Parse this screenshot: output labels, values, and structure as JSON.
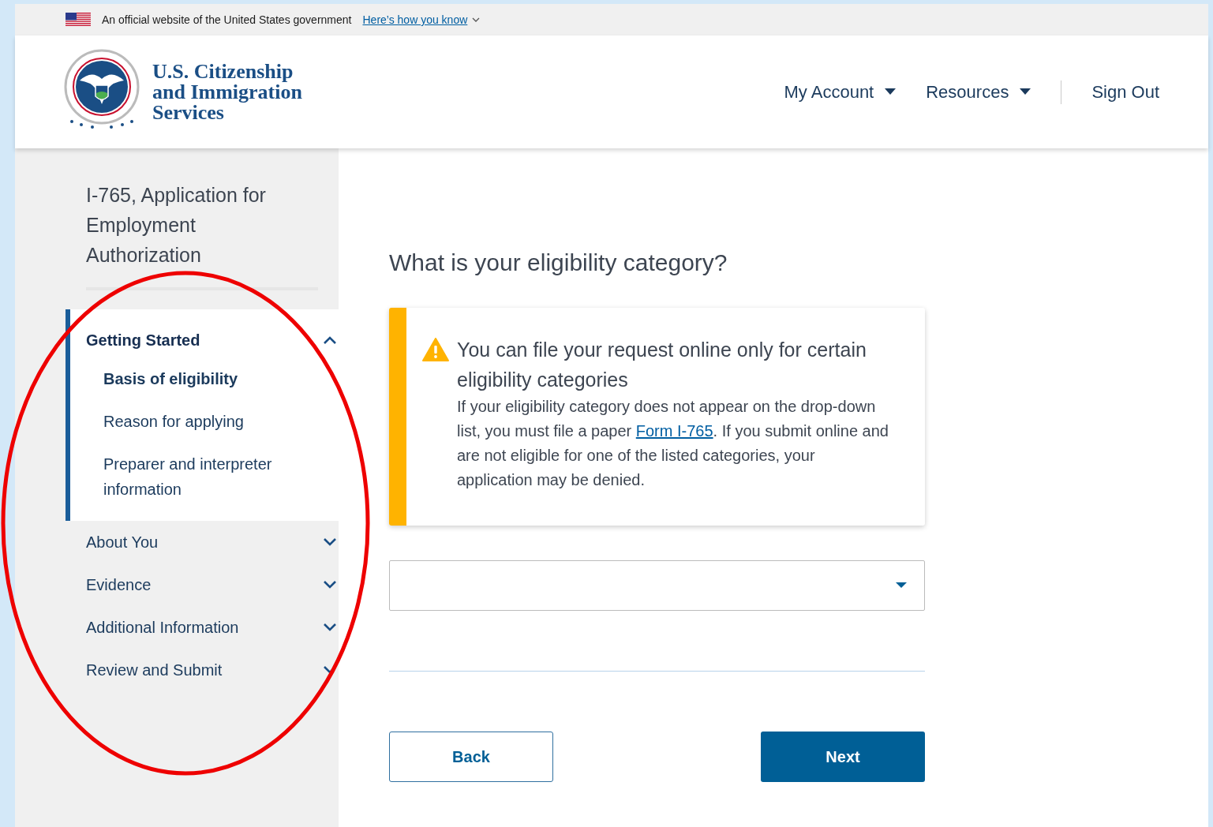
{
  "banner": {
    "text": "An official website of the United States government",
    "link": "Here’s how you know"
  },
  "header": {
    "agency_lines": [
      "U.S. Citizenship",
      "and Immigration",
      "Services"
    ],
    "nav": [
      {
        "label": "My Account",
        "kind": "dropdown"
      },
      {
        "label": "Resources",
        "kind": "dropdown"
      },
      {
        "label": "Sign Out",
        "kind": "link"
      }
    ]
  },
  "sidebar": {
    "title": "I-765, Application for Employment Authorization",
    "sections": [
      {
        "label": "Getting Started",
        "expanded": true,
        "children": [
          {
            "label": "Basis of eligibility",
            "selected": true
          },
          {
            "label": "Reason for applying",
            "selected": false
          },
          {
            "label": "Preparer and interpreter information",
            "selected": false
          }
        ]
      },
      {
        "label": "About You",
        "expanded": false
      },
      {
        "label": "Evidence",
        "expanded": false
      },
      {
        "label": "Additional Information",
        "expanded": false
      },
      {
        "label": "Review and Submit",
        "expanded": false
      }
    ]
  },
  "main": {
    "heading": "What is your eligibility category?",
    "alert": {
      "title": "You can file your request online only for certain eligibility categories",
      "body_before": "If your eligibility category does not appear on the drop-down list, you must file a paper",
      "link": "Form I-765",
      "body_after": ". If you submit online and are not eligible for one of the listed categories, your application may be denied."
    },
    "buttons": [
      {
        "label": "Back",
        "kind": "secondary"
      },
      {
        "label": "Next",
        "kind": "primary"
      }
    ]
  }
}
